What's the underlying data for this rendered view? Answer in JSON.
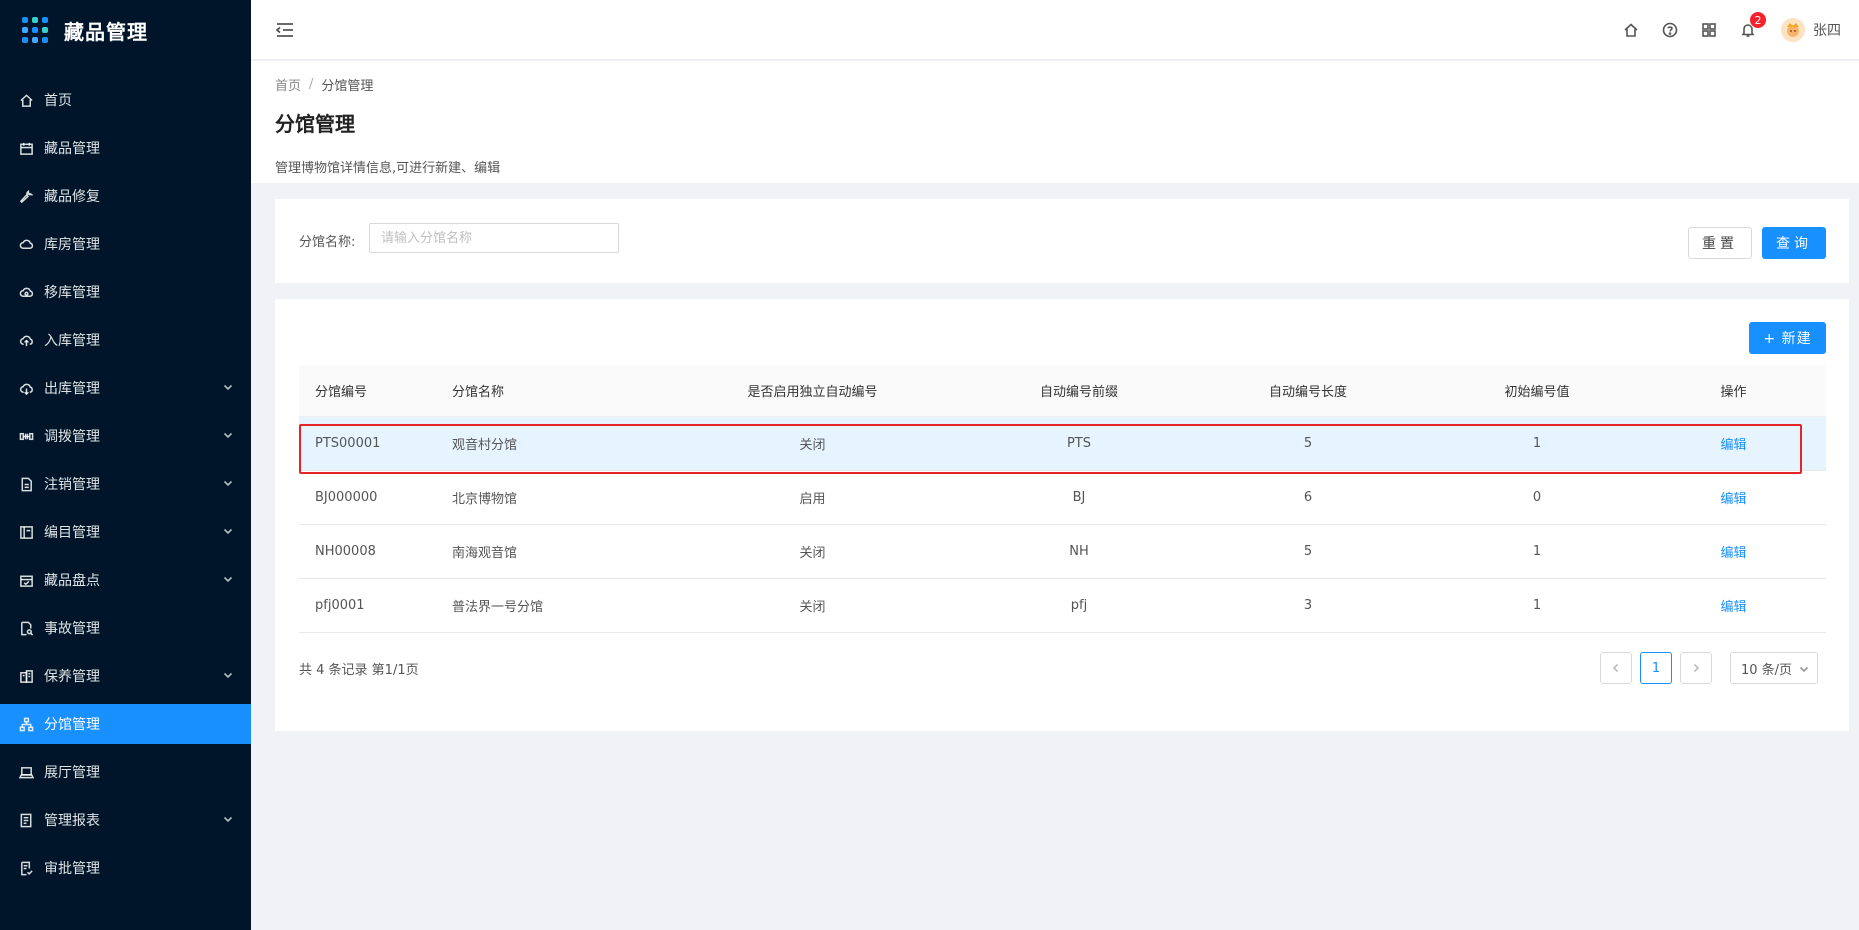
{
  "app": {
    "title": "藏品管理"
  },
  "sidebar": {
    "items": [
      {
        "label": "首页",
        "icon": "home-icon",
        "has_arrow": false
      },
      {
        "label": "藏品管理",
        "icon": "calendar-icon",
        "has_arrow": false
      },
      {
        "label": "藏品修复",
        "icon": "wrench-icon",
        "has_arrow": false
      },
      {
        "label": "库房管理",
        "icon": "cloud-icon",
        "has_arrow": false
      },
      {
        "label": "移库管理",
        "icon": "cloud-sync-icon",
        "has_arrow": false
      },
      {
        "label": "入库管理",
        "icon": "cloud-upload-icon",
        "has_arrow": false
      },
      {
        "label": "出库管理",
        "icon": "cloud-download-icon",
        "has_arrow": true
      },
      {
        "label": "调拨管理",
        "icon": "transfer-icon",
        "has_arrow": true
      },
      {
        "label": "注销管理",
        "icon": "file-icon",
        "has_arrow": true
      },
      {
        "label": "编目管理",
        "icon": "catalog-icon",
        "has_arrow": true
      },
      {
        "label": "藏品盘点",
        "icon": "calendar-check-icon",
        "has_arrow": true
      },
      {
        "label": "事故管理",
        "icon": "file-search-icon",
        "has_arrow": false
      },
      {
        "label": "保养管理",
        "icon": "building-icon",
        "has_arrow": true
      },
      {
        "label": "分馆管理",
        "icon": "cluster-icon",
        "has_arrow": false,
        "active": true
      },
      {
        "label": "展厅管理",
        "icon": "laptop-icon",
        "has_arrow": false
      },
      {
        "label": "管理报表",
        "icon": "report-icon",
        "has_arrow": true
      },
      {
        "label": "审批管理",
        "icon": "audit-icon",
        "has_arrow": false
      }
    ]
  },
  "header": {
    "notification_count": "2",
    "user_name": "张四"
  },
  "breadcrumb": {
    "home": "首页",
    "separator": "/",
    "current": "分馆管理"
  },
  "page": {
    "title": "分馆管理",
    "description": "管理博物馆详情信息,可进行新建、编辑"
  },
  "search": {
    "label": "分馆名称:",
    "placeholder": "请输入分馆名称",
    "value": "",
    "reset_label": "重置",
    "query_label": "查询"
  },
  "table": {
    "new_label": "+ 新建",
    "columns": [
      "分馆编号",
      "分馆名称",
      "是否启用独立自动编号",
      "自动编号前缀",
      "自动编号长度",
      "初始编号值",
      "操作"
    ],
    "rows": [
      {
        "code": "PTS00001",
        "name": "观音村分馆",
        "auto": "关闭",
        "prefix": "PTS",
        "length": "5",
        "start": "1",
        "action": "编辑"
      },
      {
        "code": "BJ000000",
        "name": "北京博物馆",
        "auto": "启用",
        "prefix": "BJ",
        "length": "6",
        "start": "0",
        "action": "编辑"
      },
      {
        "code": "NH00008",
        "name": "南海观音馆",
        "auto": "关闭",
        "prefix": "NH",
        "length": "5",
        "start": "1",
        "action": "编辑"
      },
      {
        "code": "pfj0001",
        "name": "普法界一号分馆",
        "auto": "关闭",
        "prefix": "pfj",
        "length": "3",
        "start": "1",
        "action": "编辑"
      }
    ]
  },
  "pagination": {
    "summary": "共 4 条记录 第1/1页",
    "current_page": "1",
    "page_size": "10 条/页"
  },
  "colors": {
    "accent": "#1890ff",
    "sidebar_bg": "#001529",
    "highlight_outline": "#e8242b"
  }
}
